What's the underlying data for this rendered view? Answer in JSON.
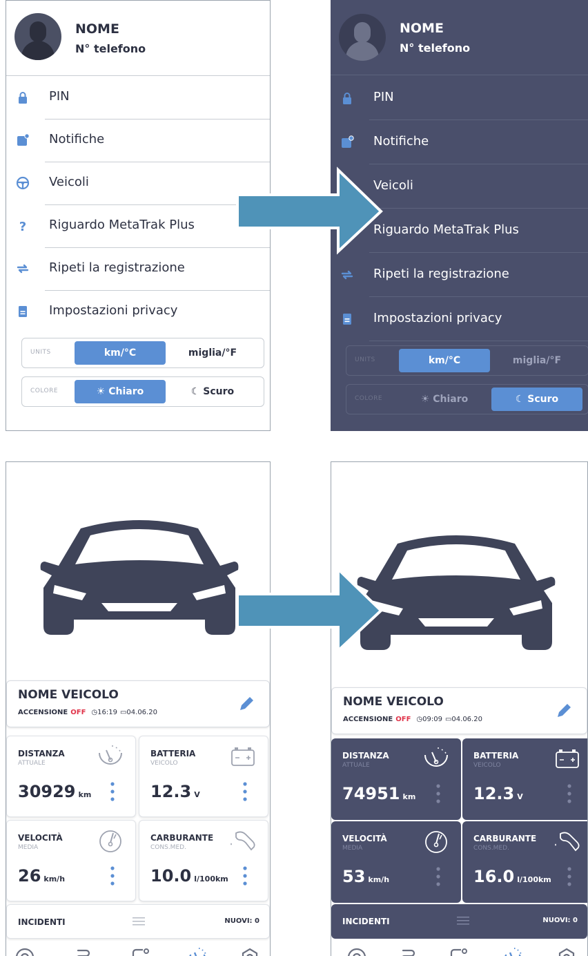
{
  "settings": {
    "name": "NOME",
    "phone": "N° telefono",
    "items": [
      {
        "label": "PIN",
        "icon": "lock-icon",
        "glyph": "🔒"
      },
      {
        "label": "Notifiche",
        "icon": "notification-icon",
        "glyph": ""
      },
      {
        "label": "Veicoli",
        "icon": "steering-wheel-icon",
        "glyph": ""
      },
      {
        "label": "Riguardo MetaTrak Plus",
        "icon": "question-icon",
        "glyph": "?"
      },
      {
        "label": "Ripeti la registrazione",
        "icon": "repeat-icon",
        "glyph": "⇄"
      },
      {
        "label": "Impostazioni privacy",
        "icon": "document-icon",
        "glyph": ""
      }
    ],
    "units": {
      "label": "UNITS",
      "option1": "km/°C",
      "option2": "miglia/°F",
      "selected": "km/°C"
    },
    "color": {
      "label": "COLORE",
      "option1": "☀ Chiaro",
      "option2": "☾ Scuro"
    },
    "light_selected_color": "☀ Chiaro",
    "dark_selected_color": "☾ Scuro"
  },
  "dashboard_light": {
    "vehicle_name": "NOME VEICOLO",
    "ignition_label": "ACCENSIONE",
    "ignition_state": "OFF",
    "time": "◷16:19",
    "date": "▭04.06.20",
    "distance": {
      "title": "DISTANZA",
      "sub": "ATTUALE",
      "value": "30929",
      "unit": "km"
    },
    "battery": {
      "title": "BATTERIA",
      "sub": "VEICOLO",
      "value": "12.3",
      "unit": "V"
    },
    "speed": {
      "title": "VELOCITÀ",
      "sub": "MEDIA",
      "value": "26",
      "unit": "km/h"
    },
    "fuel": {
      "title": "CARBURANTE",
      "sub": "CONS.MED.",
      "value": "10.0",
      "unit": "l/100km"
    },
    "incidents_label": "INCIDENTI",
    "incidents_new": "NUOVI: 0"
  },
  "dashboard_dark": {
    "vehicle_name": "NOME VEICOLO",
    "ignition_label": "ACCENSIONE",
    "ignition_state": "OFF",
    "time": "◷09:09",
    "date": "▭04.06.20",
    "distance": {
      "title": "DISTANZA",
      "sub": "ATTUALE",
      "value": "74951",
      "unit": "km"
    },
    "battery": {
      "title": "BATTERIA",
      "sub": "VEICOLO",
      "value": "12.3",
      "unit": "V"
    },
    "speed": {
      "title": "VELOCITÀ",
      "sub": "MEDIA",
      "value": "53",
      "unit": "km/h"
    },
    "fuel": {
      "title": "CARBURANTE",
      "sub": "CONS.MED.",
      "value": "16.0",
      "unit": "l/100km"
    },
    "incidents_label": "INCIDENTI",
    "incidents_new": "NUOVI: 0"
  },
  "colors": {
    "accent": "#5b8fd4",
    "dark_bg": "#4a4f6b",
    "text": "#2d3142",
    "arrow": "#4f93b8",
    "off": "#e0344a"
  },
  "nav_icons": [
    "target-icon",
    "route-icon",
    "device-icon",
    "speedometer-icon",
    "settings-icon"
  ]
}
